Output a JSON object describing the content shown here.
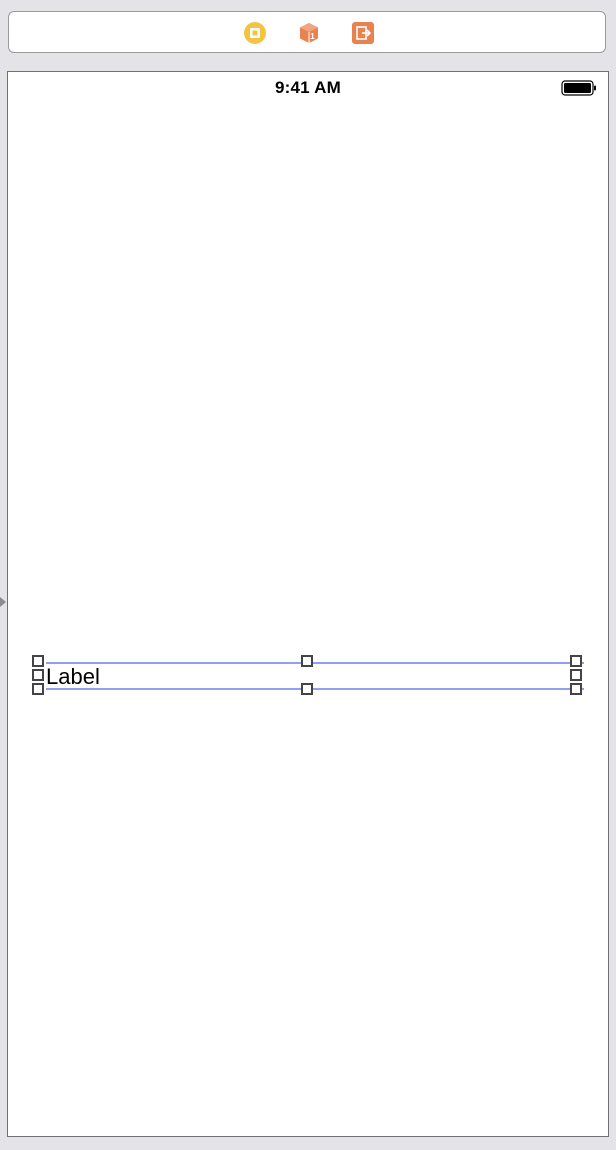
{
  "scene_dock": {
    "icons": [
      {
        "name": "view-controller-icon",
        "color": "#f5c342"
      },
      {
        "name": "first-responder-icon",
        "color": "#ea8250"
      },
      {
        "name": "exit-icon",
        "color": "#ea8250"
      }
    ]
  },
  "device": {
    "status_bar": {
      "time": "9:41 AM"
    },
    "label": {
      "text": "Label"
    }
  },
  "colors": {
    "selection_outline": "#8ea0ef",
    "handle_border": "#444446",
    "canvas_background": "#e4e4e8"
  }
}
